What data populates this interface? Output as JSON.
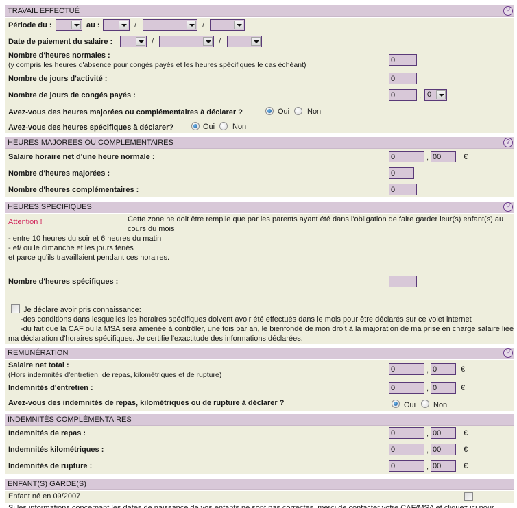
{
  "icons": {
    "help": "?",
    "euro": "€",
    "decimal_sep": ",",
    "date_sep": "/"
  },
  "travail": {
    "title": "TRAVAIL EFFECTUÉ",
    "periode_du_label": "Période du :",
    "au_label": "au :",
    "periode_du_value": "",
    "periode_au_day": "",
    "periode_au_month": "",
    "periode_au_year": "",
    "date_paiement_label": "Date de paiement du salaire :",
    "date_paiement_day": "",
    "date_paiement_month": "",
    "date_paiement_year": "",
    "heures_normales_label": "Nombre d'heures normales :",
    "heures_normales_sub": "(y compris les heures d'absence pour congés payés et les heures spécifiques le cas échéant)",
    "heures_normales_value": "0",
    "jours_activite_label": "Nombre de jours d'activité :",
    "jours_activite_value": "0",
    "conges_label": "Nombre de jours de congés payés :",
    "conges_value": "0",
    "conges_decimal": "0",
    "majorees_question": "Avez-vous des heures majorées ou complémentaires à déclarer ?",
    "majorees_answer": "Oui",
    "specifiques_question": "Avez-vous des heures spécifiques à déclarer?",
    "specifiques_answer": "Oui",
    "oui": "Oui",
    "non": "Non"
  },
  "majorees": {
    "title": "HEURES MAJOREES OU COMPLEMENTAIRES",
    "salaire_horaire_label": "Salaire horaire net d'une heure normale :",
    "salaire_horaire_int": "0",
    "salaire_horaire_dec": "00",
    "heures_majorees_label": "Nombre d'heures majorées :",
    "heures_majorees_value": "0",
    "heures_compl_label": "Nombre d'heures complémentaires :",
    "heures_compl_value": "0"
  },
  "specifiques": {
    "title": "HEURES SPECIFIQUES",
    "attention": "Attention !",
    "intro_line1": "Cette zone ne doit être remplie que par les parents ayant été dans l'obligation de faire garder leur(s) enfant(s) au",
    "intro_line2": "cours du mois",
    "bullet1": "- entre 10 heures du soir et 6 heures du matin",
    "bullet2": "- et/ ou le dimanche et les jours fériés",
    "bullet3": "et parce qu'ils travaillaient pendant ces horaires.",
    "nb_heures_label": "Nombre d'heures spécifiques :",
    "nb_heures_value": "",
    "declare_label": "Je déclare avoir pris connaissance:",
    "declare_checked": false,
    "declare_line1": "-des conditions dans lesquelles les horaires spécifiques doivent avoir été effectués dans le mois pour être déclarés sur ce volet internet",
    "declare_line2": "-du fait que la CAF ou la MSA sera amenée à contrôler, une fois par an, le bienfondé de mon droit à la majoration de ma prise en charge salaire liée",
    "declare_line3": "ma déclaration d'horaires spécifiques. Je certifie l'exactitude des informations déclarées."
  },
  "remuneration": {
    "title": "REMUNÉRATION",
    "salaire_net_label": "Salaire net total :",
    "salaire_net_sub": "(Hors indemnités d'entretien, de repas, kilométriques et de rupture)",
    "salaire_net_int": "0",
    "salaire_net_dec": "0",
    "entretien_label": "Indemnités d'entretien :",
    "entretien_int": "0",
    "entretien_dec": "0",
    "indemnites_question": "Avez-vous des indemnités de repas, kilométriques ou de rupture à déclarer ?",
    "indemnites_answer": "Oui",
    "oui": "Oui",
    "non": "Non"
  },
  "complementaires": {
    "title": "INDEMNITÉS COMPLÉMENTAIRES",
    "repas_label": "Indemnités de repas :",
    "repas_int": "0",
    "repas_dec": "00",
    "km_label": "Indemnités kilométriques :",
    "km_int": "0",
    "km_dec": "00",
    "rupture_label": "Indemnités de rupture :",
    "rupture_int": "0",
    "rupture_dec": "00"
  },
  "enfants": {
    "title": "ENFANT(S) GARDE(S)",
    "enfant1_label": "Enfant né en 09/2007",
    "enfant1_checked": false,
    "note": "Si les informations concernant les dates de naissance de vos enfants ne sont pas correctes, merci de contacter votre CAF/MSA et cliquez ici pour"
  }
}
